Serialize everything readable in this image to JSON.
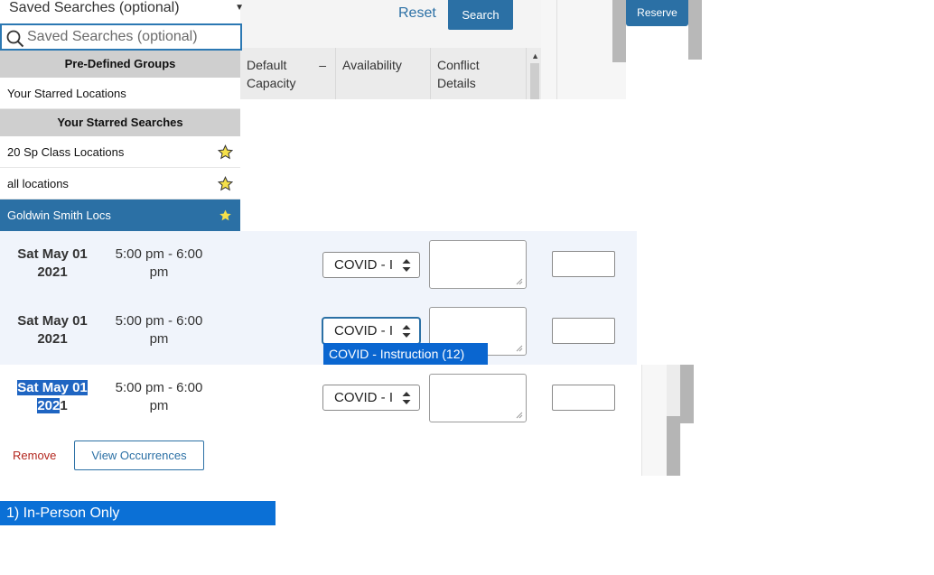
{
  "saved_searches": {
    "top_label": "Saved Searches (optional)",
    "placeholder": "Saved Searches (optional)",
    "groups": [
      {
        "header": "Pre-Defined Groups",
        "items": [
          "Your Starred Locations"
        ]
      },
      {
        "header": "Your Starred Searches",
        "items": [
          "20 Sp Class Locations",
          "all locations",
          "Goldwin Smith Locs"
        ]
      }
    ],
    "selected_item": "Goldwin Smith Locs"
  },
  "toolbar": {
    "reset_label": "Reset",
    "search_label": "Search",
    "reserve_label": "Reserve"
  },
  "columns": [
    {
      "label": "Default Capacity",
      "sort_symbol": "–"
    },
    {
      "label": "Availability"
    },
    {
      "label": "Conflict Details"
    }
  ],
  "occurrences": [
    {
      "date_line1": "Sat May 01",
      "date_line2": "2021",
      "time_line1": "5:00 pm - 6:00",
      "time_line2": "pm",
      "select_value": "COVID - I"
    },
    {
      "date_line1": "Sat May 01",
      "date_line2": "2021",
      "time_line1": "5:00 pm - 6:00",
      "time_line2": "pm",
      "select_value": "COVID - I"
    },
    {
      "date_line1": "Sat May 01",
      "date_line2": "2021",
      "time_line1": "5:00 pm - 6:00",
      "time_line2": "pm",
      "select_value": "COVID - I"
    }
  ],
  "open_dropdown": {
    "option": "COVID - Instruction (12)"
  },
  "actions": {
    "remove_label": "Remove",
    "view_occurrences_label": "View Occurrences"
  },
  "in_person_option": "1) In-Person Only",
  "colors": {
    "accent": "#2b70a5",
    "selected_option": "#0a66d0",
    "remove_red": "#b3261e",
    "star_yellow": "#f5e04a"
  },
  "icons": [
    "search-icon",
    "star-icon",
    "select-arrows-icon",
    "resize-grip-icon",
    "chevron-down-icon",
    "scroll-up-icon"
  ]
}
